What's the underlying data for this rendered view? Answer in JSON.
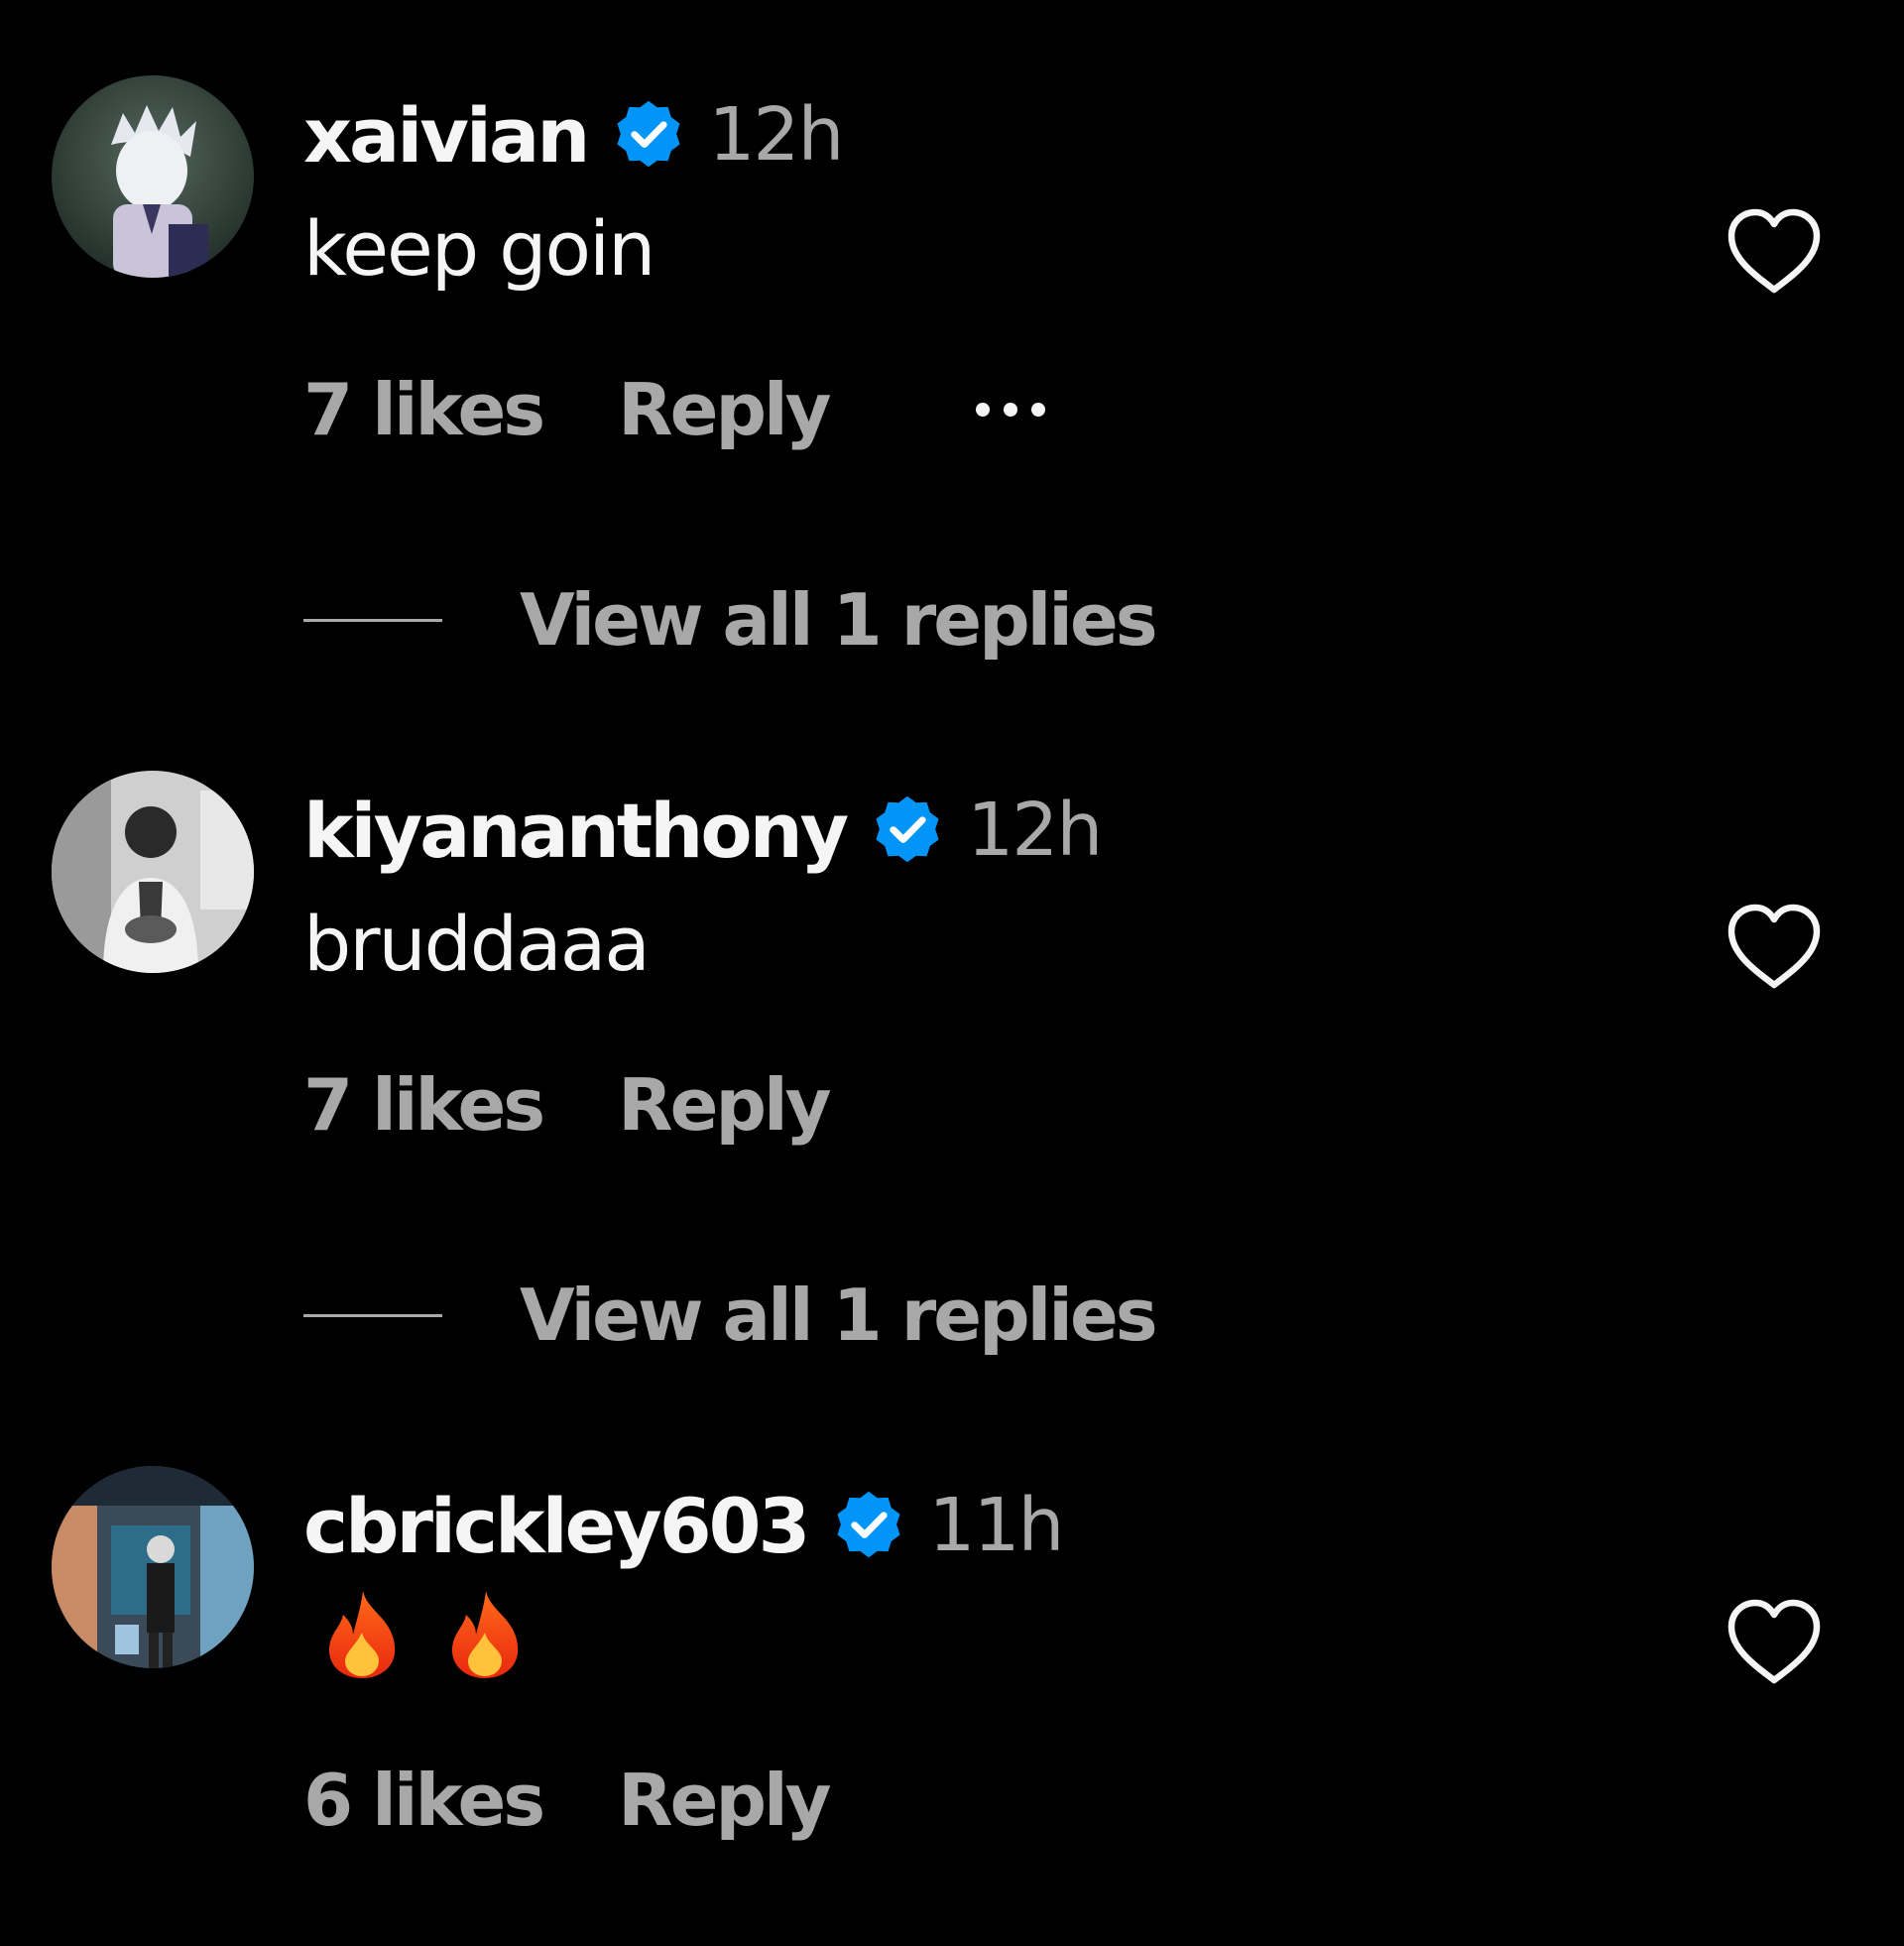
{
  "comments": [
    {
      "username": "xaivian",
      "time": "12h",
      "text": "keep goin",
      "likes": "7 likes",
      "reply_label": "Reply",
      "view_replies": "View all 1 replies",
      "verified": true,
      "avatar_icon": "anime-character-avatar"
    },
    {
      "username": "kiyananthony",
      "time": "12h",
      "text": "bruddaaa",
      "likes": "7 likes",
      "reply_label": "Reply",
      "view_replies": "View all 1 replies",
      "verified": true,
      "avatar_icon": "grayscale-person-avatar"
    },
    {
      "username": "cbrickley603",
      "time": "11h",
      "text": "🔥🔥",
      "likes": "6 likes",
      "reply_label": "Reply",
      "verified": true,
      "avatar_icon": "storefront-person-avatar"
    }
  ],
  "colors": {
    "background": "#000000",
    "primary_text": "#f5f5f5",
    "secondary_text": "#a8a8a8",
    "verified_blue": "#0095f6"
  }
}
